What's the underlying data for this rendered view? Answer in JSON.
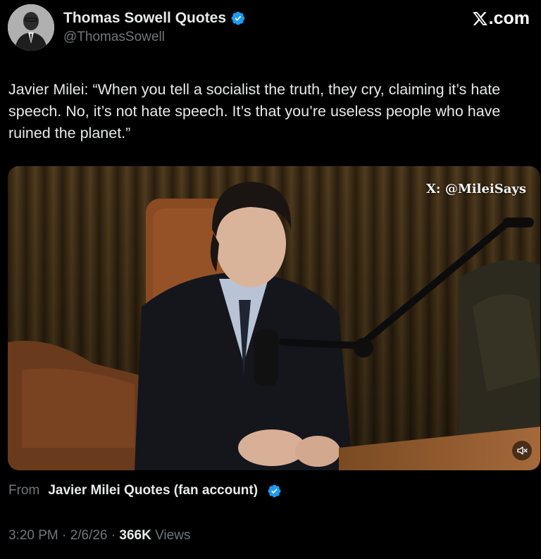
{
  "author": {
    "name": "Thomas Sowell Quotes",
    "handle": "@ThomasSowell",
    "verified": true
  },
  "brand": {
    "label": ".com",
    "icon": "x-logo-icon"
  },
  "tweet": {
    "text": "Javier Milei: “When you tell a socialist the truth, they cry, claiming it’s hate speech. No, it’s not hate speech. It’s that you’re useless people who have ruined the planet.”"
  },
  "media": {
    "watermark": "X: @MileiSays",
    "mute_icon": "speaker-muted-icon"
  },
  "source": {
    "label": "From",
    "name": "Javier Milei Quotes (fan account)",
    "verified": true
  },
  "meta": {
    "time": "3:20 PM",
    "separator": "·",
    "date": "2/6/26",
    "views_count": "366K",
    "views_label": "Views"
  },
  "colors": {
    "background": "#000000",
    "primary_text": "#e7e9ea",
    "secondary_text": "#71767b",
    "verified_blue": "#1d9bf0"
  }
}
